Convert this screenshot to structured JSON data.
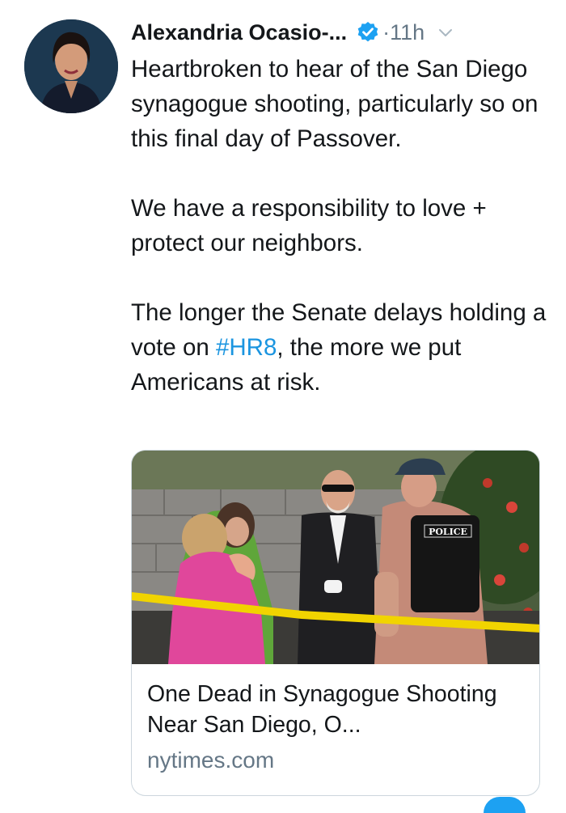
{
  "tweet": {
    "author_name": "Alexandria Ocasio-...",
    "separator": "·",
    "timestamp": "11h",
    "paragraphs": [
      "Heartbroken to hear of the San Diego synagogue shooting, particularly so on this final day of Passover.",
      "We have a responsibility to love + protect our neighbors."
    ],
    "p3_before": "The longer the Senate delays holding a vote on ",
    "hashtag": "#HR8",
    "p3_after": ", the more we put Americans at risk."
  },
  "card": {
    "image_badge": "POLICE",
    "title": "One Dead in Synagogue Shooting Near San Diego, O...",
    "domain": "nytimes.com"
  },
  "icons": {
    "verified": "verified-badge-icon",
    "more": "chevron-down-icon"
  },
  "colors": {
    "link": "#1b95e0",
    "secondary_text": "#657786",
    "verified": "#1da1f2",
    "border": "#ccd6dd"
  }
}
